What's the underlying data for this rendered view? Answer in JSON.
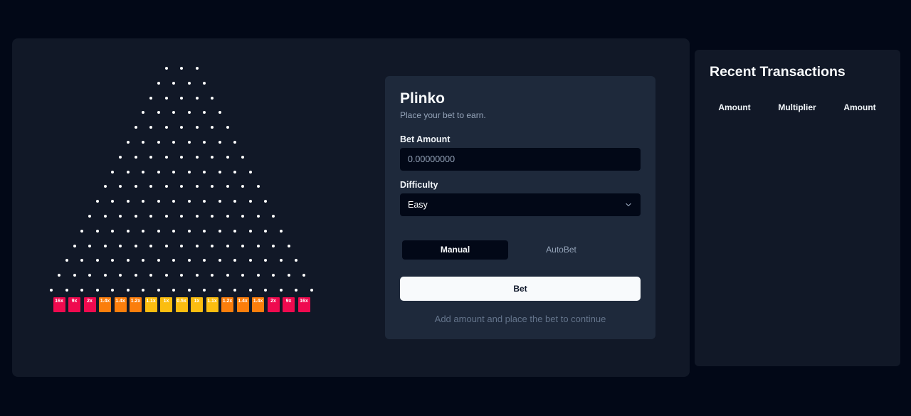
{
  "game": {
    "board": {
      "peg_rows": 16,
      "multipliers": [
        "16x",
        "9x",
        "2x",
        "1.4x",
        "1.4x",
        "1.2x",
        "1.1x",
        "1x",
        "0.5x",
        "1x",
        "1.1x",
        "1.2x",
        "1.4x",
        "1.4x",
        "2x",
        "9x",
        "16x"
      ],
      "bucket_colors": [
        "#ef0a4f",
        "#ef0a4f",
        "#ef0a4f",
        "#fb7e0c",
        "#fb7e0c",
        "#fb7e0c",
        "#fbbd10",
        "#fbbd10",
        "#fbbd10",
        "#fbbd10",
        "#fbbd10",
        "#fb7e0c",
        "#fb7e0c",
        "#fb7e0c",
        "#ef0a4f",
        "#ef0a4f",
        "#ef0a4f"
      ]
    },
    "bet_card": {
      "title": "Plinko",
      "subtitle": "Place your bet to earn.",
      "bet_amount_label": "Bet Amount",
      "bet_amount_placeholder": "0.00000000",
      "difficulty_label": "Difficulty",
      "difficulty_value": "Easy",
      "tabs": {
        "manual": "Manual",
        "autobet": "AutoBet"
      },
      "bet_button": "Bet",
      "hint": "Add amount and place the bet to continue"
    }
  },
  "transactions": {
    "title": "Recent Transactions",
    "columns": [
      "Amount",
      "Multiplier",
      "Amount"
    ]
  },
  "colors": {
    "background": "#020817",
    "panel": "#111827",
    "card": "#1e293b",
    "red": "#ef0a4f",
    "orange": "#fb7e0c",
    "yellow": "#fbbd10"
  }
}
